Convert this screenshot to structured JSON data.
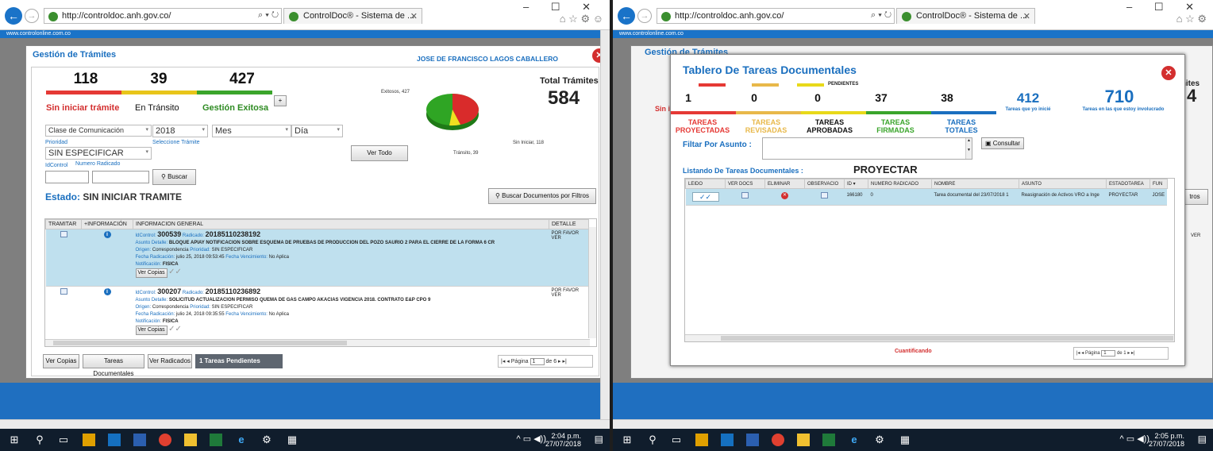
{
  "browser": {
    "url": "http://controldoc.anh.gov.co/",
    "tab_title": "ControlDoc® - Sistema de ...",
    "site_banner": "www.controlonline.com.co"
  },
  "left": {
    "dialog_title": "Gestión de Trámites",
    "user": "JOSE DE FRANCISCO LAGOS CABALLERO",
    "stats": [
      {
        "value": "118",
        "label": "Sin iniciar trámite",
        "color": "#e53935"
      },
      {
        "value": "39",
        "label": "En Tránsito",
        "color": "#e8c51a"
      },
      {
        "value": "427",
        "label": "Gestión Exitosa",
        "color": "#3aa52b"
      }
    ],
    "plus": "+",
    "total_label": "Total Trámites",
    "total_value": "584",
    "pie": {
      "exitosos": "Exitosos, 427",
      "sin_iniciar": "Sin Iniciar, 118",
      "transito": "Tránsito, 39"
    },
    "filters": {
      "clase": "Clase de Comunicación",
      "anio": "2018",
      "mes": "Mes",
      "dia": "Día",
      "prioridad_label": "Prioridad",
      "seleccione": "Seleccione Trámite",
      "prioridad": "SIN ESPECIFICAR",
      "idcontrol_label": "IdControl",
      "radicado_label": "Numero Radicado"
    },
    "buscar": "Buscar",
    "ver_todo": "Ver Todo",
    "estado_prefix": "Estado:",
    "estado": "SIN INICIAR TRAMITE",
    "buscar_docs": "Buscar Documentos por Filtros",
    "table_headers": [
      "TRAMITAR",
      "+INFORMACIÓN",
      "INFORMACION GENERAL",
      "DETALLE"
    ],
    "rows": [
      {
        "idcontrol": "300539",
        "radicado": "20185110238192",
        "asunto": "BLOQUE APIAY NOTIFICACION SOBRE ESQUEMA DE PRUEBAS DE PRODUCCION DEL POZO SAURIO 2 PARA EL CIERRE DE LA FORMA 6 CR",
        "origen": "Correspondencia",
        "prioridad": "SIN ESPECIFICAR",
        "fecha_rad": "julio 25, 2018 09:53:45",
        "vencimiento": "No Aplica",
        "notificacion": "FISICA",
        "detalle": "POR FAVOR VER"
      },
      {
        "idcontrol": "300207",
        "radicado": "20185110236892",
        "asunto": "SOLICITUD ACTUALIZACION PERMISO QUEMA DE GAS CAMPO AKACIAS VIGENCIA 2018. CONTRATO E&P CPO 9",
        "origen": "Correspondencia",
        "prioridad": "SIN ESPECIFICAR",
        "fecha_rad": "julio 24, 2018 09:35:55",
        "vencimiento": "No Aplica",
        "notificacion": "FISICA",
        "detalle": "POR FAVOR VER"
      }
    ],
    "keys": {
      "idcontrol": "IdControl:",
      "radicado": "Radicado:",
      "asunto": "Asunto Detalle:",
      "origen": "Origen:",
      "prioridad": "Prioridad:",
      "fecha": "Fecha Radicación:",
      "venc": "Fecha Vencimiento:",
      "notif": "Notificación:",
      "ver_copias": "Ver Copias"
    },
    "bottom_buttons": [
      "Ver Copias",
      "Tareas Documentales",
      "Ver Radicados"
    ],
    "pendientes": "1 Tareas Pendientes",
    "pagina": "Página",
    "page_current": "1",
    "page_of": "de 6",
    "clock_time": "2:04 p.m.",
    "clock_date": "27/07/2018"
  },
  "right": {
    "bg_title": "Gestión de Trámites",
    "dialog_title": "Tablero De Tareas Documentales",
    "pendientes": "PENDIENTES",
    "counts": [
      {
        "value": "1",
        "label": "TAREAS\nPROYECTADAS",
        "color": "#e53935"
      },
      {
        "value": "0",
        "label": "TAREAS\nREVISADAS",
        "color": "#e8b84a"
      },
      {
        "value": "0",
        "label": "TAREAS\nAPROBADAS",
        "color": "#e8d91a"
      },
      {
        "value": "37",
        "label": "TAREAS\nFIRMADAS",
        "color": "#3aa52b"
      },
      {
        "value": "38",
        "label": "TAREAS\nTOTALES",
        "color": "#1a6fbf"
      }
    ],
    "inicie_value": "412",
    "inicie_label": "Tareas que yo inicié",
    "involucrado_value": "710",
    "involucrado_label": "Tareas en las que estoy involucrado",
    "filtrar": "Filtar Por Asunto :",
    "consultar": "Consultar",
    "listado": "Listando De Tareas Documentales :",
    "proyectar": "PROYECTAR",
    "headers": [
      "LEIDO",
      "VER DOCS",
      "ELIMINAR",
      "OBSERVACIO",
      "ID ▾",
      "NUMERO RADICADO",
      "NOMBRE",
      "ASUNTO",
      "ESTADOTAREA",
      "FUN"
    ],
    "row": {
      "id": "166180",
      "radicado": "0",
      "nombre": "Tarea documental del 23/07/2018 1",
      "asunto": "Reasignación de Activos VRO a Inge",
      "estado": "PROYECTAR",
      "fun": "JOSE"
    },
    "cuantificando": "Cuantificando",
    "pagina": "Página",
    "page_current": "1",
    "page_of": "de 1",
    "bg_tramites": "mites",
    "bg_total": "4",
    "bg_sin": "Sin i",
    "bg_filtros": "tros",
    "bg_ver": "VER",
    "clock_time": "2:05 p.m.",
    "clock_date": "27/07/2018"
  }
}
